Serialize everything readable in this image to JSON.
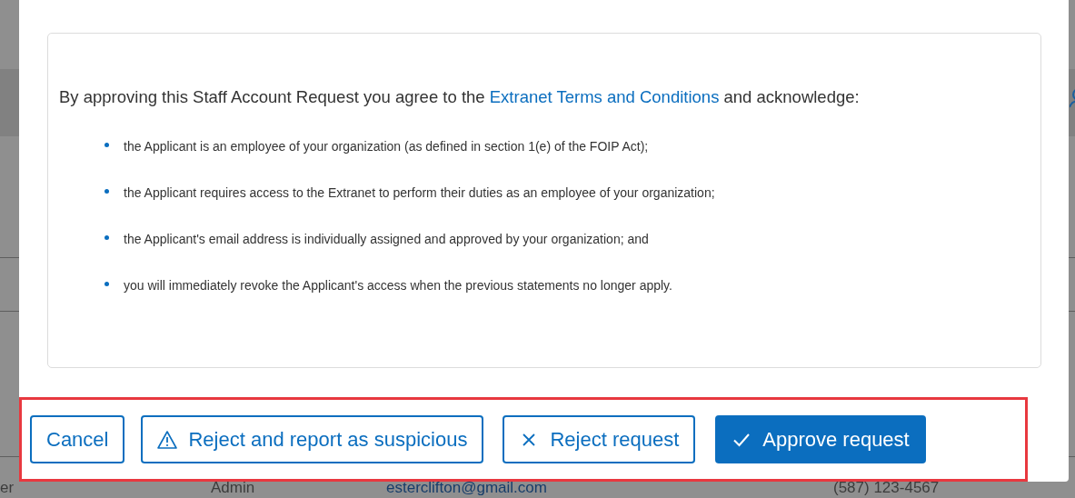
{
  "background_row": {
    "cells": [
      "er",
      "Admin",
      "esterclifton@gmail.com",
      "(587) 123-4567"
    ]
  },
  "modal": {
    "intro": {
      "before": "By approving this Staff Account Request you agree to the",
      "link": "Extranet Terms and Conditions",
      "after": "and acknowledge:"
    },
    "bullets": [
      "the Applicant is an employee of your organization (as defined in section 1(e) of the FOIP Act);",
      "the Applicant requires access to the Extranet to perform their duties as an employee of your organization;",
      "the Applicant's email address is individually assigned and approved by your organization; and",
      "you will immediately revoke the Applicant's access when the previous statements no longer apply."
    ],
    "buttons": [
      {
        "label": "Cancel",
        "kind": "cancel"
      },
      {
        "label": "Reject and report as suspicious",
        "kind": "report"
      },
      {
        "label": "Reject request",
        "kind": "reject"
      },
      {
        "label": "Approve request",
        "kind": "approve"
      }
    ]
  }
}
